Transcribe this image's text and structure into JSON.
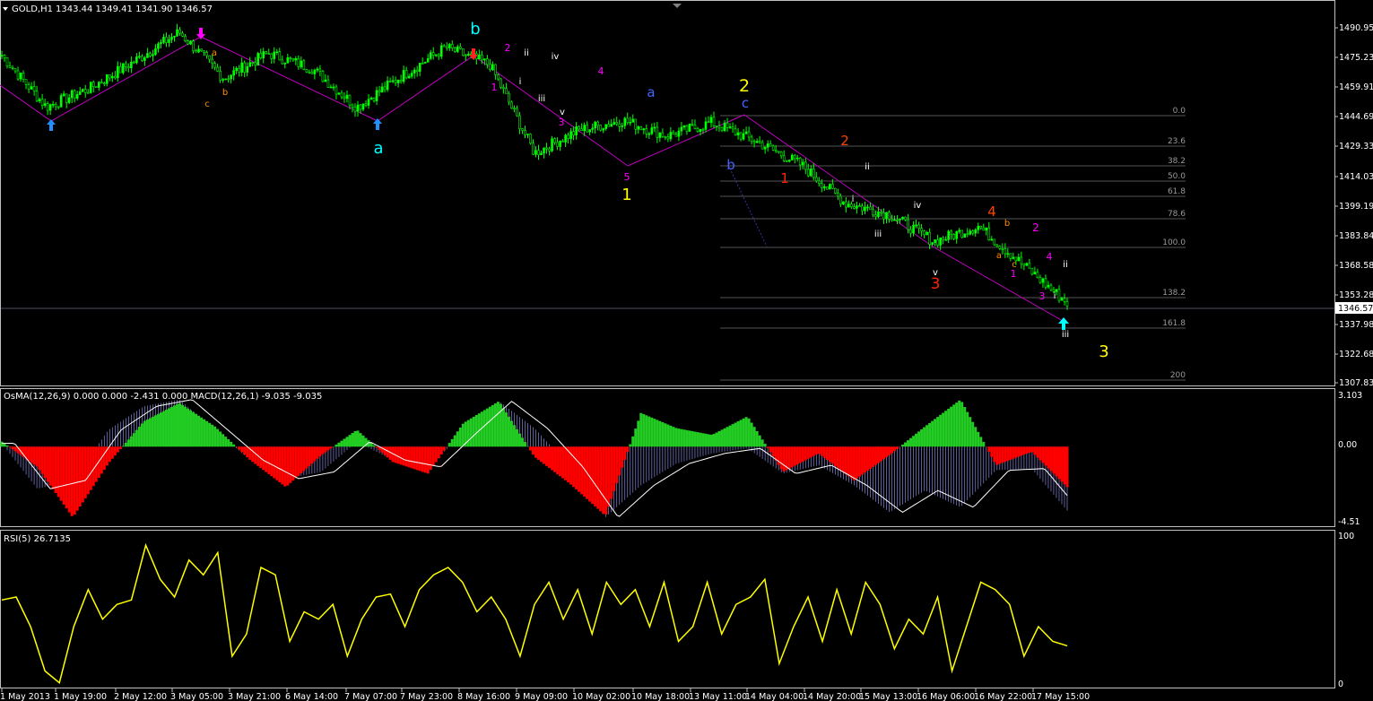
{
  "colors": {
    "background": "#000000",
    "grid": "#3a3a3a",
    "candle_up": "#00ff00",
    "candle_down": "#00ff00",
    "wave_line": "#c000c0",
    "osma_pos": "#22cc22",
    "osma_neg": "#ff0000",
    "macd_hist": "#8888dd",
    "signal_line": "#ffffff",
    "rsi_line": "#ffff00",
    "fib_line": "#707070",
    "price_line": "#a0a0c0"
  },
  "header": {
    "symbol": "GOLD,H1",
    "ohlc": "1343.44 1349.41 1341.90 1346.57"
  },
  "price_panel": {
    "axis_ticks": [
      "1490.95",
      "1475.23",
      "1459.91",
      "1444.69",
      "1429.33",
      "1414.03",
      "1399.19",
      "1383.84",
      "1368.58",
      "1353.28",
      "1337.98",
      "1322.68",
      "1307.83"
    ],
    "current_price": "1346.57"
  },
  "osma_panel": {
    "label": "OsMA(12,26,9) 0.000 0.000 -2.431 0.000  MACD(12,26,1) -9.035 -9.035",
    "axis_ticks": [
      "3.103",
      "0.00",
      "-4.51"
    ]
  },
  "rsi_panel": {
    "label": "RSI(5) 26.7135",
    "axis_ticks": [
      "100",
      "0"
    ]
  },
  "time_axis": {
    "labels": [
      "1 May 2013",
      "1 May 19:00",
      "2 May 12:00",
      "3 May 05:00",
      "3 May 21:00",
      "6 May 14:00",
      "7 May 07:00",
      "7 May 23:00",
      "8 May 16:00",
      "9 May 09:00",
      "10 May 02:00",
      "10 May 18:00",
      "13 May 11:00",
      "14 May 04:00",
      "14 May 20:00",
      "15 May 13:00",
      "16 May 06:00",
      "16 May 22:00",
      "17 May 15:00"
    ]
  },
  "fib_levels": [
    "0.0",
    "23.6",
    "38.2",
    "50.0",
    "61.8",
    "78.6",
    "100.0",
    "138.2",
    "161.8",
    "200"
  ],
  "wave_labels": [
    {
      "text": "b",
      "color": "#00ffff"
    },
    {
      "text": "a",
      "color": "#00ffff"
    },
    {
      "text": "c",
      "color": "#ff8c00"
    },
    {
      "text": "a",
      "color": "#ff8c00"
    },
    {
      "text": "b",
      "color": "#ff8c00"
    },
    {
      "text": "2",
      "color": "#ff00ff"
    },
    {
      "text": "1",
      "color": "#ff00ff"
    },
    {
      "text": "ii",
      "color": "#ffffff"
    },
    {
      "text": "i",
      "color": "#ffffff"
    },
    {
      "text": "iv",
      "color": "#ffffff"
    },
    {
      "text": "iii",
      "color": "#ffffff"
    },
    {
      "text": "v",
      "color": "#ffffff"
    },
    {
      "text": "3",
      "color": "#ff00ff"
    },
    {
      "text": "4",
      "color": "#ff00ff"
    },
    {
      "text": "5",
      "color": "#ff00ff"
    },
    {
      "text": "1",
      "color": "#ffff00"
    },
    {
      "text": "a",
      "color": "#4466ff"
    },
    {
      "text": "2",
      "color": "#ffff00"
    },
    {
      "text": "c",
      "color": "#4466ff"
    },
    {
      "text": "b",
      "color": "#4466ff"
    },
    {
      "text": "1",
      "color": "#ff2200"
    },
    {
      "text": "2",
      "color": "#ff4400"
    },
    {
      "text": "ii",
      "color": "#ffffff"
    },
    {
      "text": "i",
      "color": "#ffffff"
    },
    {
      "text": "iv",
      "color": "#ffffff"
    },
    {
      "text": "iii",
      "color": "#ffffff"
    },
    {
      "text": "v",
      "color": "#ffffff"
    },
    {
      "text": "3",
      "color": "#ff2200"
    },
    {
      "text": "4",
      "color": "#ff4400"
    },
    {
      "text": "b",
      "color": "#ff8c00"
    },
    {
      "text": "a",
      "color": "#ff8c00"
    },
    {
      "text": "c",
      "color": "#ff8c00"
    },
    {
      "text": "2",
      "color": "#ff00ff"
    },
    {
      "text": "1",
      "color": "#ff00ff"
    },
    {
      "text": "4",
      "color": "#ff00ff"
    },
    {
      "text": "3",
      "color": "#ff00ff"
    },
    {
      "text": "i",
      "color": "#ffffff"
    },
    {
      "text": "ii",
      "color": "#ffffff"
    },
    {
      "text": "iii",
      "color": "#ffffff"
    },
    {
      "text": "3",
      "color": "#ffff00"
    }
  ],
  "chart_data": [
    {
      "type": "line",
      "title": "GOLD,H1",
      "ohlc_last": {
        "open": 1343.44,
        "high": 1349.41,
        "low": 1341.9,
        "close": 1346.57
      },
      "ylim": [
        1303,
        1500
      ],
      "x": [
        "1 May 2013",
        "1 May 19:00",
        "2 May 12:00",
        "3 May 05:00",
        "3 May 21:00",
        "6 May 14:00",
        "7 May 07:00",
        "7 May 23:00",
        "8 May 16:00",
        "9 May 09:00",
        "10 May 02:00",
        "10 May 18:00",
        "13 May 11:00",
        "14 May 04:00",
        "14 May 20:00",
        "15 May 13:00",
        "16 May 06:00",
        "16 May 22:00",
        "17 May 15:00"
      ],
      "series": [
        {
          "values": [
            1475,
            1448,
            1458,
            1472,
            1487,
            1463,
            1476,
            1468,
            1448,
            1464,
            1479,
            1470,
            1424,
            1436,
            1441,
            1433,
            1440,
            1430,
            1418,
            1398,
            1392,
            1378,
            1386,
            1366,
            1346
          ]
        }
      ]
    },
    {
      "type": "bar",
      "title": "OsMA(12,26,9) 0.000 0.000 -2.431 0.000  MACD(12,26,1) -9.035 -9.035",
      "ylim": [
        -4.51,
        3.103
      ],
      "series": [
        {
          "values": [
            0.3,
            -1.2,
            -4.2,
            -1.0,
            1.5,
            2.6,
            1.2,
            -0.8,
            -2.4,
            -0.5,
            1.0,
            -0.9,
            -1.6,
            1.4,
            2.7,
            -0.6,
            -2.2,
            -4.1,
            2.0,
            1.1,
            0.7,
            1.8,
            -1.5,
            -0.4,
            -2.0,
            -0.5,
            1.2,
            2.8,
            -1.1,
            -0.3,
            -2.4
          ]
        },
        {
          "values": [
            0.2,
            -2.5,
            -2.0,
            1.0,
            2.4,
            2.8,
            1.0,
            -0.8,
            -1.9,
            -1.5,
            0.3,
            -0.8,
            -1.2,
            0.8,
            2.7,
            1.1,
            -1.2,
            -4.2,
            -2.3,
            -1.0,
            -0.4,
            -0.1,
            -1.6,
            -1.1,
            -2.3,
            -3.9,
            -2.6,
            -3.6,
            -1.4,
            -1.3,
            -3.8
          ]
        }
      ]
    },
    {
      "type": "line",
      "title": "RSI(5) 26.7135",
      "ylim": [
        0,
        100
      ],
      "series": [
        {
          "values": [
            58,
            60,
            40,
            10,
            2,
            40,
            65,
            45,
            55,
            58,
            95,
            72,
            60,
            85,
            75,
            90,
            20,
            35,
            80,
            75,
            30,
            50,
            45,
            55,
            20,
            45,
            60,
            62,
            40,
            65,
            75,
            80,
            70,
            50,
            60,
            45,
            20,
            55,
            70,
            45,
            65,
            35,
            70,
            55,
            65,
            40,
            70,
            30,
            40,
            70,
            35,
            55,
            60,
            72,
            15,
            40,
            60,
            30,
            65,
            35,
            70,
            55,
            25,
            45,
            35,
            60,
            10,
            40,
            70,
            65,
            55,
            20,
            40,
            30,
            27
          ]
        }
      ]
    }
  ]
}
